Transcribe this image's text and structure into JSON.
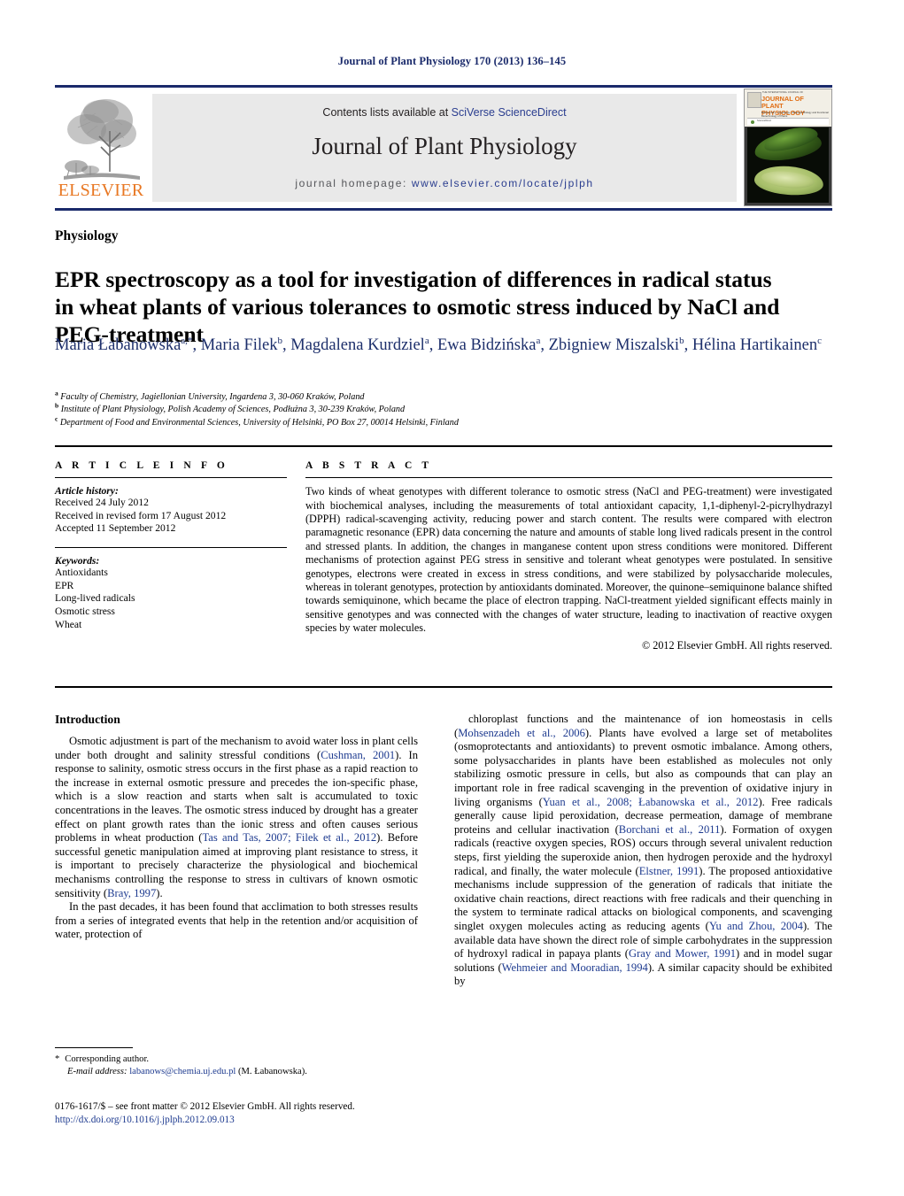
{
  "running_head": "Journal of Plant Physiology 170 (2013) 136–145",
  "masthead": {
    "contents_prefix": "Contents lists available at ",
    "sciencedirect": "SciVerse ScienceDirect",
    "journal_title": "Journal of Plant Physiology",
    "homepage_prefix": "journal homepage:",
    "homepage_url": "www.elsevier.com/locate/jplph",
    "publisher": "ELSEVIER",
    "accent_orange": "#e87722",
    "accent_blue": "#2a3d8f",
    "cover": {
      "tiny_top": "THE INTERNATIONAL JOURNAL OF",
      "title": "JOURNAL OF PLANT PHYSIOLOGY",
      "subtitle": "Biochemistry · Physiology · Molecular Biology and Functional Biotechnology of Plants",
      "bar_text": "ScienceDirect"
    }
  },
  "section_label": "Physiology",
  "article_title": "EPR spectroscopy as a tool for investigation of differences in radical status in wheat plants of various tolerances to osmotic stress induced by NaCl and PEG-treatment",
  "authors": [
    {
      "name": "Maria Łabanowska",
      "marks": "a,*"
    },
    {
      "name": "Maria Filek",
      "marks": "b"
    },
    {
      "name": "Magdalena Kurdziel",
      "marks": "a"
    },
    {
      "name": "Ewa Bidzińska",
      "marks": "a"
    },
    {
      "name": "Zbigniew Miszalski",
      "marks": "b"
    },
    {
      "name": "Hélina Hartikainen",
      "marks": "c"
    }
  ],
  "affiliations": [
    {
      "mark": "a",
      "text": "Faculty of Chemistry, Jagiellonian University, Ingardena 3, 30-060 Kraków, Poland"
    },
    {
      "mark": "b",
      "text": "Institute of Plant Physiology, Polish Academy of Sciences, Podłużna 3, 30-239 Kraków, Poland"
    },
    {
      "mark": "c",
      "text": "Department of Food and Environmental Sciences, University of Helsinki, PO Box 27, 00014 Helsinki, Finland"
    }
  ],
  "article_info": {
    "header": "A R T I C L E   I N F O",
    "history_label": "Article history:",
    "history": [
      "Received 24 July 2012",
      "Received in revised form 17 August 2012",
      "Accepted 11 September 2012"
    ],
    "keywords_label": "Keywords:",
    "keywords": [
      "Antioxidants",
      "EPR",
      "Long-lived radicals",
      "Osmotic stress",
      "Wheat"
    ]
  },
  "abstract": {
    "header": "A B S T R A C T",
    "text": "Two kinds of wheat genotypes with different tolerance to osmotic stress (NaCl and PEG-treatment) were investigated with biochemical analyses, including the measurements of total antioxidant capacity, 1,1-diphenyl-2-picrylhydrazyl (DPPH) radical-scavenging activity, reducing power and starch content. The results were compared with electron paramagnetic resonance (EPR) data concerning the nature and amounts of stable long lived radicals present in the control and stressed plants. In addition, the changes in manganese content upon stress conditions were monitored. Different mechanisms of protection against PEG stress in sensitive and tolerant wheat genotypes were postulated. In sensitive genotypes, electrons were created in excess in stress conditions, and were stabilized by polysaccharide molecules, whereas in tolerant genotypes, protection by antioxidants dominated. Moreover, the quinone–semiquinone balance shifted towards semiquinone, which became the place of electron trapping. NaCl-treatment yielded significant effects mainly in sensitive genotypes and was connected with the changes of water structure, leading to inactivation of reactive oxygen species by water molecules.",
    "copyright": "© 2012 Elsevier GmbH. All rights reserved."
  },
  "body": {
    "introduction_heading": "Introduction",
    "left_paragraphs": [
      {
        "segments": [
          {
            "t": "Osmotic adjustment is part of the mechanism to avoid water loss in plant cells under both drought and salinity stressful conditions (",
            "cit": false
          },
          {
            "t": "Cushman, 2001",
            "cit": true
          },
          {
            "t": "). In response to salinity, osmotic stress occurs in the first phase as a rapid reaction to the increase in external osmotic pressure and precedes the ion-specific phase, which is a slow reaction and starts when salt is accumulated to toxic concentrations in the leaves. The osmotic stress induced by drought has a greater effect on plant growth rates than the ionic stress and often causes serious problems in wheat production (",
            "cit": false
          },
          {
            "t": "Tas and Tas, 2007; Filek et al., 2012",
            "cit": true
          },
          {
            "t": "). Before successful genetic manipulation aimed at improving plant resistance to stress, it is important to precisely characterize the physiological and biochemical mechanisms controlling the response to stress in cultivars of known osmotic sensitivity (",
            "cit": false
          },
          {
            "t": "Bray, 1997",
            "cit": true
          },
          {
            "t": ").",
            "cit": false
          }
        ]
      },
      {
        "segments": [
          {
            "t": "In the past decades, it has been found that acclimation to both stresses results from a series of integrated events that help in the retention and/or acquisition of water, protection of",
            "cit": false
          }
        ]
      }
    ],
    "right_paragraphs": [
      {
        "segments": [
          {
            "t": "chloroplast functions and the maintenance of ion homeostasis in cells (",
            "cit": false
          },
          {
            "t": "Mohsenzadeh et al., 2006",
            "cit": true
          },
          {
            "t": "). Plants have evolved a large set of metabolites (osmoprotectants and antioxidants) to prevent osmotic imbalance. Among others, some polysaccharides in plants have been established as molecules not only stabilizing osmotic pressure in cells, but also as compounds that can play an important role in free radical scavenging in the prevention of oxidative injury in living organisms (",
            "cit": false
          },
          {
            "t": "Yuan et al., 2008; Łabanowska et al., 2012",
            "cit": true
          },
          {
            "t": "). Free radicals generally cause lipid peroxidation, decrease permeation, damage of membrane proteins and cellular inactivation (",
            "cit": false
          },
          {
            "t": "Borchani et al., 2011",
            "cit": true
          },
          {
            "t": "). Formation of oxygen radicals (reactive oxygen species, ROS) occurs through several univalent reduction steps, first yielding the superoxide anion, then hydrogen peroxide and the hydroxyl radical, and finally, the water molecule (",
            "cit": false
          },
          {
            "t": "Elstner, 1991",
            "cit": true
          },
          {
            "t": "). The proposed antioxidative mechanisms include suppression of the generation of radicals that initiate the oxidative chain reactions, direct reactions with free radicals and their quenching in the system to terminate radical attacks on biological components, and scavenging singlet oxygen molecules acting as reducing agents (",
            "cit": false
          },
          {
            "t": "Yu and Zhou, 2004",
            "cit": true
          },
          {
            "t": "). The available data have shown the direct role of simple carbohydrates in the suppression of hydroxyl radical in papaya plants (",
            "cit": false
          },
          {
            "t": "Gray and Mower, 1991",
            "cit": true
          },
          {
            "t": ") and in model sugar solutions (",
            "cit": false
          },
          {
            "t": "Wehmeier and Mooradian, 1994",
            "cit": true
          },
          {
            "t": "). A similar capacity should be exhibited by",
            "cit": false
          }
        ]
      }
    ]
  },
  "footer": {
    "corresponding_star": "*",
    "corresponding_label": "Corresponding author.",
    "email_label": "E-mail address:",
    "email": "labanows@chemia.uj.edu.pl",
    "email_owner": "(M. Łabanowska).",
    "issn_line": "0176-1617/$ – see front matter © 2012 Elsevier GmbH. All rights reserved.",
    "doi_line": "http://dx.doi.org/10.1016/j.jplph.2012.09.013"
  }
}
